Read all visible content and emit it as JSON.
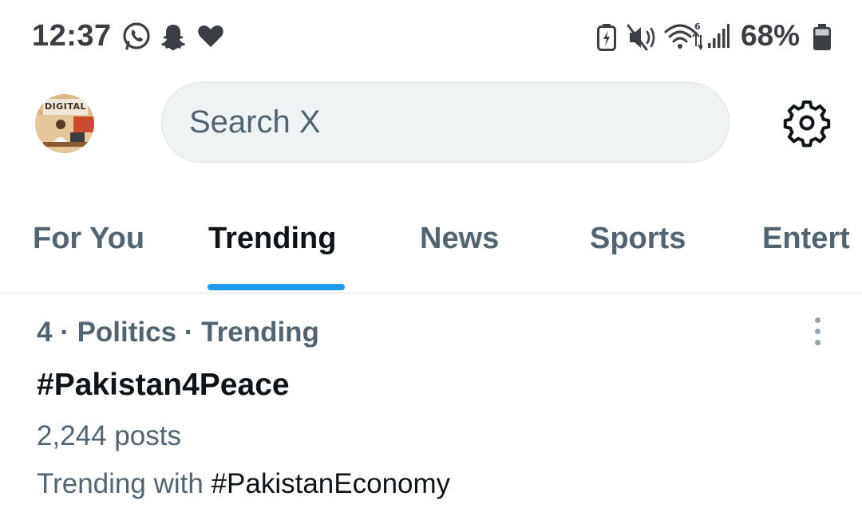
{
  "status_bar": {
    "time": "12:37",
    "battery_percent": "68%",
    "left_icons": [
      "whatsapp-icon",
      "snapchat-icon",
      "heart-icon"
    ],
    "right_icons": [
      "battery-saver-icon",
      "mute-icon",
      "wifi-icon",
      "signal-icon",
      "battery-icon"
    ]
  },
  "header": {
    "avatar_text": "DIGITAL",
    "search_placeholder": "Search X"
  },
  "tabs": [
    {
      "label": "For You",
      "active": false
    },
    {
      "label": "Trending",
      "active": true
    },
    {
      "label": "News",
      "active": false
    },
    {
      "label": "Sports",
      "active": false
    },
    {
      "label": "Entert",
      "active": false
    }
  ],
  "trend": {
    "meta": "4 · Politics · Trending",
    "name": "#Pakistan4Peace",
    "posts": "2,244 posts",
    "with_label": "Trending with",
    "with_tag": "#PakistanEconomy"
  },
  "colors": {
    "accent": "#1d9bf0",
    "secondary_text": "#536471",
    "primary_text": "#0f1419",
    "search_bg": "#eff3f4"
  }
}
